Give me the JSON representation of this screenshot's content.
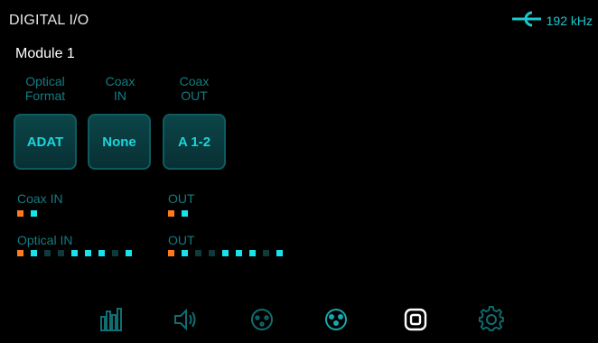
{
  "header": {
    "title": "DIGITAL I/O",
    "sample_rate": "192 kHz",
    "clock_icon": "clock-source-icon",
    "accent_color": "#19c9cf"
  },
  "module": {
    "title": "Module 1"
  },
  "columns": [
    {
      "label": "Optical\nFormat",
      "value": "ADAT"
    },
    {
      "label": "Coax\nIN",
      "value": "None"
    },
    {
      "label": "Coax\nOUT",
      "value": "A 1-2"
    }
  ],
  "meters": {
    "coax_in": {
      "label": "Coax IN",
      "leds": [
        "orange",
        "cyan"
      ]
    },
    "coax_out": {
      "label": "OUT",
      "leds": [
        "orange",
        "cyan"
      ]
    },
    "optical_in": {
      "label": "Optical IN",
      "leds": [
        "orange",
        "cyan",
        "dim",
        "dim",
        "cyan",
        "cyan",
        "cyan",
        "dim",
        "cyan"
      ]
    },
    "optical_out": {
      "label": "OUT",
      "leds": [
        "orange",
        "cyan",
        "dim",
        "dim",
        "cyan",
        "cyan",
        "cyan",
        "dim",
        "cyan"
      ]
    }
  },
  "led_colors": {
    "orange": "#ff7a1a",
    "cyan": "#19e3ea",
    "dim": "#0e3a3c"
  },
  "nav": [
    {
      "name": "meters-icon",
      "active": false
    },
    {
      "name": "speaker-icon",
      "active": false
    },
    {
      "name": "xlr-female-icon",
      "active": false
    },
    {
      "name": "xlr-male-icon",
      "active": false
    },
    {
      "name": "digital-io-icon",
      "active": true
    },
    {
      "name": "settings-gear-icon",
      "active": false
    }
  ]
}
